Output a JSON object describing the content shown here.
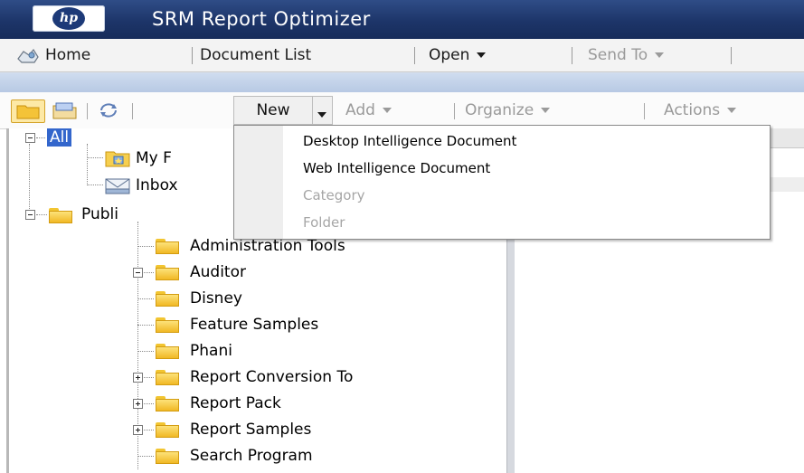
{
  "app": {
    "title": "SRM Report Optimizer",
    "logo_text": "hp"
  },
  "nav": {
    "home": "Home",
    "document_list": "Document List",
    "open": "Open",
    "send_to": "Send To"
  },
  "toolbar": {
    "new": "New",
    "add": "Add",
    "organize": "Organize",
    "actions": "Actions"
  },
  "tree": {
    "root": "All",
    "my_favorites": "My F",
    "inbox": "Inbox",
    "public": "Publi",
    "items": [
      "Administration Tools",
      "Auditor",
      "Disney",
      "Feature Samples",
      "Phani",
      "Report Conversion To",
      "Report Pack",
      "Report Samples",
      "Search Program"
    ]
  },
  "new_menu": {
    "items": [
      {
        "label": "Desktop Intelligence Document",
        "enabled": true
      },
      {
        "label": "Web Intelligence Document",
        "enabled": true
      },
      {
        "label": "Category",
        "enabled": false
      },
      {
        "label": "Folder",
        "enabled": false
      }
    ]
  },
  "icons": [
    "hp-logo",
    "home-icon",
    "folders-icon",
    "categories-icon",
    "refresh-icon",
    "inbox-icon",
    "favorites-folder-icon",
    "folder-icon",
    "tree-expand-icon",
    "tree-collapse-icon"
  ]
}
